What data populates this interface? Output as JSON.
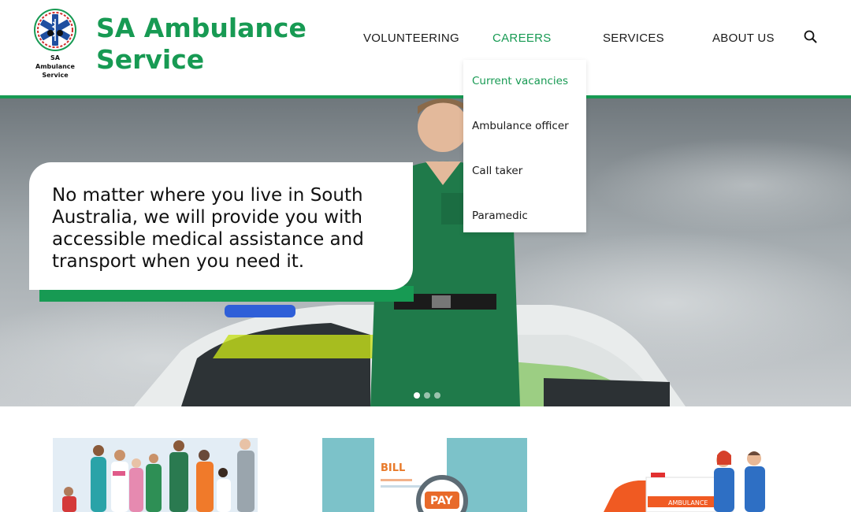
{
  "brand": {
    "logo_text": [
      "SA",
      "Ambulance",
      "Service"
    ],
    "title_line1": "SA Ambulance",
    "title_line2": "Service"
  },
  "nav": {
    "items": [
      {
        "label": "VOLUNTEERING",
        "active": false
      },
      {
        "label": "CAREERS",
        "active": true
      },
      {
        "label": "SERVICES",
        "active": false
      },
      {
        "label": "ABOUT US",
        "active": false
      }
    ],
    "search_icon": "search-icon"
  },
  "dropdown": {
    "parent": "CAREERS",
    "items": [
      {
        "label": "Current vacancies",
        "active": true
      },
      {
        "label": "Ambulance officer",
        "active": false
      },
      {
        "label": "Call taker",
        "active": false
      },
      {
        "label": "Paramedic",
        "active": false
      }
    ]
  },
  "hero": {
    "text": "No matter where you live in South Australia, we will provide you with accessible medical assistance and transport when you need it.",
    "slides": 3,
    "active_slide": 1
  },
  "cards": [
    {
      "image": "diverse-community-illustration"
    },
    {
      "image": "bill-pay-illustration",
      "label_bill": "BILL",
      "label_pay": "PAY"
    },
    {
      "image": "ambulance-staff-illustration",
      "label": "AMBULANCE"
    }
  ],
  "colors": {
    "brand_green": "#179a53",
    "text": "#1a1a1a",
    "accent_yellow": "#c5e01a"
  }
}
